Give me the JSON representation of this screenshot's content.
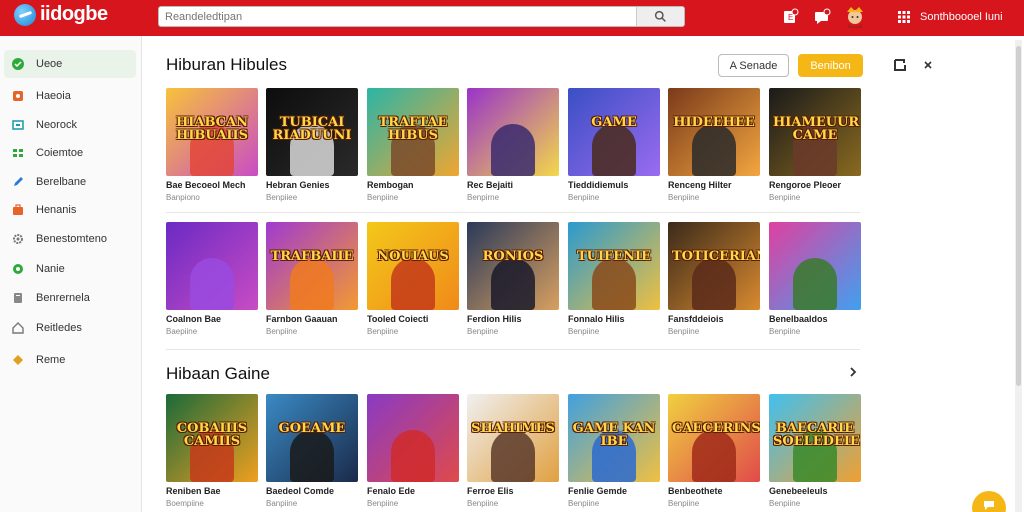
{
  "brand": {
    "name": "iidogbe"
  },
  "search": {
    "placeholder": "Reandeledtipan"
  },
  "user": {
    "name": "Sonthboooel Iuni"
  },
  "sidebar": {
    "items": [
      {
        "label": "Ueoe",
        "icon": "home-icon",
        "color": "#2eaa3a",
        "active": true
      },
      {
        "label": "Haeoia",
        "icon": "fire-icon",
        "color": "#e8622a"
      },
      {
        "label": "Neorock",
        "icon": "monitor-icon",
        "color": "#1a9aa8"
      },
      {
        "label": "Coiemtoe",
        "icon": "grid-icon",
        "color": "#2eaa3a"
      },
      {
        "label": "Berelbane",
        "icon": "pencil-icon",
        "color": "#2a7ad6"
      },
      {
        "label": "Henanis",
        "icon": "bag-icon",
        "color": "#e8622a"
      },
      {
        "label": "Benestomteno",
        "icon": "gear-icon",
        "color": "#777777"
      },
      {
        "label": "Nanie",
        "icon": "circle-icon",
        "color": "#2eaa3a"
      },
      {
        "label": "Benrernela",
        "icon": "box-icon",
        "color": "#888888"
      },
      {
        "label": "Reitledes",
        "icon": "house-icon",
        "color": "#777777"
      },
      {
        "label": "Reme",
        "icon": "diamond-icon",
        "color": "#e0a020"
      }
    ]
  },
  "section1": {
    "title": "Hiburan Hibules",
    "sort_label": "A Senade",
    "gold_label": "Benibon",
    "cards": [
      {
        "thumb_text": "HIABCAN HIBUAIIS",
        "name": "Bae Becoeol Mech",
        "sub": "Banpiono",
        "bg1": "#f7c23a",
        "bg2": "#c94cc4",
        "fig": "#e2473a"
      },
      {
        "thumb_text": "TUBICAI RIADUUNI",
        "name": "Hebran Genies",
        "sub": "Benpiiee",
        "bg1": "#0d0d0d",
        "bg2": "#2a2a2a",
        "fig": "#d9d9d9"
      },
      {
        "thumb_text": "TRAFTAE HIBUS",
        "name": "Rembogan",
        "sub": "Benpiine",
        "bg1": "#2bb5a6",
        "bg2": "#f0a630",
        "fig": "#7a4a2a"
      },
      {
        "thumb_text": "",
        "name": "Rec Bejaiti",
        "sub": "Benpirne",
        "bg1": "#9a33c9",
        "bg2": "#f3d84a",
        "fig": "#3a2a70"
      },
      {
        "thumb_text": "GAME",
        "name": "Tieddidiemuls",
        "sub": "Benpiine",
        "bg1": "#3a4fc4",
        "bg2": "#9a6bf0",
        "fig": "#4a2a1a"
      },
      {
        "thumb_text": "HIDEEHEE",
        "name": "Renceng Hilter",
        "sub": "Benpiine",
        "bg1": "#7a3a1a",
        "bg2": "#f3a640",
        "fig": "#2a2a2a"
      },
      {
        "thumb_text": "HIAMEUUR CAME",
        "name": "Rengoroe Pleoer",
        "sub": "Benpiine",
        "bg1": "#1a1a1a",
        "bg2": "#8a6a20",
        "fig": "#6a3a2a"
      }
    ]
  },
  "section2": {
    "cards": [
      {
        "thumb_text": "",
        "name": "Coalnon Bae",
        "sub": "Baepiine",
        "bg1": "#6a2ac4",
        "bg2": "#c94cc4",
        "fig": "#9a4ae0"
      },
      {
        "thumb_text": "TRAFBAIIE",
        "name": "Farnbon Gaauan",
        "sub": "Benpiine",
        "bg1": "#a03ad0",
        "bg2": "#f39a30",
        "fig": "#f07a20"
      },
      {
        "thumb_text": "NOUIAUS",
        "name": "Tooled Coiecti",
        "sub": "Benpiine",
        "bg1": "#f3c81a",
        "bg2": "#f08a1a",
        "fig": "#c43a1a"
      },
      {
        "thumb_text": "RONIOS",
        "name": "Ferdion Hilis",
        "sub": "Benpiine",
        "bg1": "#2a3a5a",
        "bg2": "#d9a060",
        "fig": "#1a1a2a"
      },
      {
        "thumb_text": "TUIFENIE",
        "name": "Fonnalo Hilis",
        "sub": "Benpiine",
        "bg1": "#2a9ad0",
        "bg2": "#f0c040",
        "fig": "#8a4a1a"
      },
      {
        "thumb_text": "TOTICERIANS",
        "name": "Fansfddeiois",
        "sub": "Benpiine",
        "bg1": "#3a2a1a",
        "bg2": "#d98a30",
        "fig": "#5a2a1a"
      },
      {
        "thumb_text": "",
        "name": "Benelbaaldos",
        "sub": "Benpiine",
        "bg1": "#e040a0",
        "bg2": "#40a0f0",
        "fig": "#3a7a2a"
      }
    ]
  },
  "section3": {
    "title": "Hibaan Gaine",
    "cards": [
      {
        "thumb_text": "COBAIIIS CAMIIS",
        "name": "Reniben Bae",
        "sub": "Boempiine",
        "bg1": "#1a6a3a",
        "bg2": "#f0a020",
        "fig": "#c43a1a"
      },
      {
        "thumb_text": "GOEAME",
        "name": "Baedeol Comde",
        "sub": "Banpiine",
        "bg1": "#3a8ac4",
        "bg2": "#1a2a4a",
        "fig": "#1a1a1a"
      },
      {
        "thumb_text": "",
        "name": "Fenalo Ede",
        "sub": "Benpiine",
        "bg1": "#8a3ac4",
        "bg2": "#e04a4a",
        "fig": "#d02a2a"
      },
      {
        "thumb_text": "SHAHIMES",
        "name": "Ferroe Elis",
        "sub": "Benpiine",
        "bg1": "#f0f0f0",
        "bg2": "#e0a040",
        "fig": "#5a3a2a"
      },
      {
        "thumb_text": "GAME KAN IBE",
        "name": "Fenlie Gemde",
        "sub": "Benpiine",
        "bg1": "#40a0e0",
        "bg2": "#f0c040",
        "fig": "#2a6ad0"
      },
      {
        "thumb_text": "CAECERINS",
        "name": "Benbeothete",
        "sub": "Benpiine",
        "bg1": "#f0d040",
        "bg2": "#e04a4a",
        "fig": "#a02a1a"
      },
      {
        "thumb_text": "BAECARIE SOELEDEIE",
        "name": "Genebeeleuls",
        "sub": "Benpiine",
        "bg1": "#40c0f0",
        "bg2": "#f0a030",
        "fig": "#3a8a2a"
      }
    ]
  }
}
